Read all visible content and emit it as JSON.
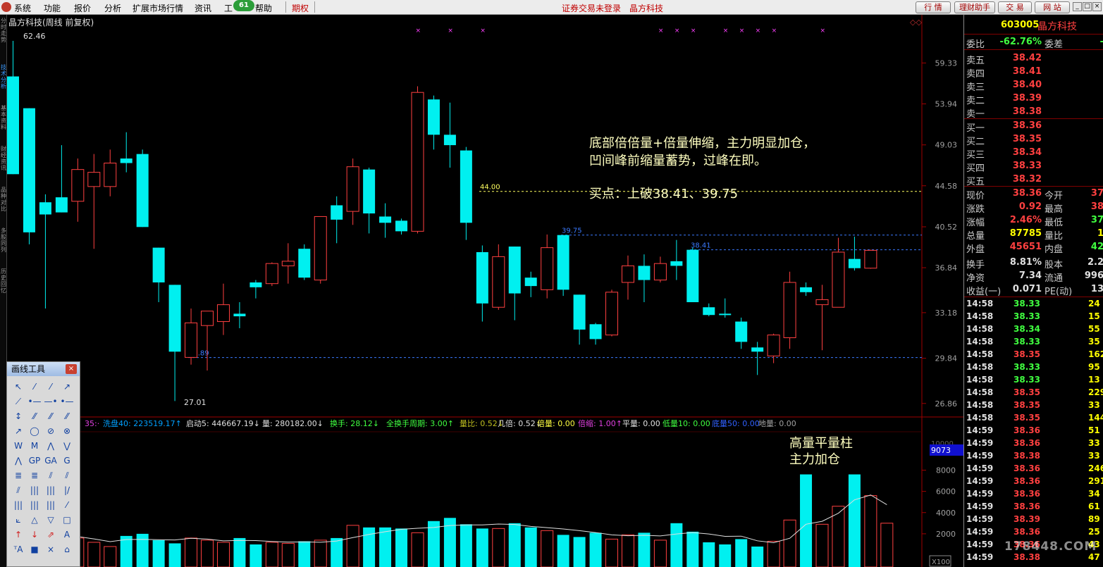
{
  "menubar": {
    "items": [
      "系统",
      "功能",
      "报价",
      "分析",
      "扩展市场行情",
      "资讯",
      "工",
      "帮助"
    ],
    "badge": "61",
    "qiquan": "期权",
    "status_text": "证券交易未登录",
    "status_name": "晶方科技",
    "right_buttons": [
      "行 情",
      "理财助手",
      "交 易",
      "网 站"
    ],
    "window_controls": [
      "_",
      "□",
      "×"
    ]
  },
  "left_tabs": [
    "分时走势",
    "技术分析",
    "基本资料",
    "财经资讯",
    "品种对比",
    "多股同列",
    "历史回忆"
  ],
  "chart": {
    "title": "晶方科技(周线 前复权)",
    "high_label": "62.46",
    "low_label": "27.01",
    "y_ticks": [
      "59.33",
      "53.94",
      "49.03",
      "44.58",
      "40.52",
      "36.84",
      "33.18",
      "29.84",
      "26.86"
    ],
    "y_values": [
      59.33,
      53.94,
      49.03,
      44.58,
      40.52,
      36.84,
      33.18,
      29.84,
      26.86
    ],
    "lines": [
      {
        "label": "44.00",
        "value": 44.0,
        "color": "#ffff60"
      },
      {
        "label": "39.75",
        "value": 39.75,
        "color": "#3a7aff"
      },
      {
        "label": "38.41",
        "value": 38.41,
        "color": "#3a7aff"
      },
      {
        "label": "29.89",
        "value": 29.89,
        "color": "#3a7aff"
      }
    ],
    "annotation_lines": [
      "底部倍倍量+倍量伸缩，主力明显加仓，",
      "凹间峰前缩量蓄势，过峰在即。"
    ],
    "buy_point": "买点：上破38.41、39.75",
    "signal_marks": [
      "×",
      "×",
      "×",
      "×",
      "×",
      "×",
      "×",
      "×",
      "×",
      "×",
      "×"
    ],
    "candles": [
      {
        "o": 57.5,
        "c": 45.8,
        "h": 62.46,
        "l": 45.8
      },
      {
        "o": 53.4,
        "c": 40.0,
        "h": 53.4,
        "l": 38.9
      },
      {
        "o": 42.9,
        "c": 41.7,
        "h": 43.7,
        "l": 33.5
      },
      {
        "o": 43.4,
        "c": 41.9,
        "h": 49.0,
        "l": 41.9
      },
      {
        "o": 43.0,
        "c": 46.3,
        "h": 47.5,
        "l": 41.0
      },
      {
        "o": 44.5,
        "c": 46.0,
        "h": 48.0,
        "l": 38.5
      },
      {
        "o": 44.5,
        "c": 47.0,
        "h": 48.5,
        "l": 43.5
      },
      {
        "o": 47.5,
        "c": 47.0,
        "h": 50.5,
        "l": 46.0
      },
      {
        "o": 48.0,
        "c": 40.5,
        "h": 48.5,
        "l": 40.5
      },
      {
        "o": 38.6,
        "c": 35.6,
        "h": 38.6,
        "l": 34.0
      },
      {
        "o": 35.4,
        "c": 30.3,
        "h": 35.4,
        "l": 27.01
      },
      {
        "o": 29.9,
        "c": 32.4,
        "h": 33.5,
        "l": 29.4
      },
      {
        "o": 32.2,
        "c": 33.3,
        "h": 33.3,
        "l": 29.0
      },
      {
        "o": 32.5,
        "c": 33.8,
        "h": 35.5,
        "l": 31.5
      },
      {
        "o": 33.1,
        "c": 32.9,
        "h": 34.0,
        "l": 32.0
      },
      {
        "o": 35.6,
        "c": 35.2,
        "h": 35.8,
        "l": 34.3
      },
      {
        "o": 35.5,
        "c": 37.2,
        "h": 37.3,
        "l": 35.3
      },
      {
        "o": 37.0,
        "c": 37.4,
        "h": 39.0,
        "l": 35.5
      },
      {
        "o": 38.5,
        "c": 36.0,
        "h": 38.9,
        "l": 35.8
      },
      {
        "o": 35.8,
        "c": 41.5,
        "h": 41.5,
        "l": 35.5
      },
      {
        "o": 42.6,
        "c": 41.2,
        "h": 43.5,
        "l": 39.0
      },
      {
        "o": 42.0,
        "c": 46.6,
        "h": 47.5,
        "l": 40.7
      },
      {
        "o": 46.3,
        "c": 41.8,
        "h": 46.5,
        "l": 39.9
      },
      {
        "o": 41.5,
        "c": 40.9,
        "h": 42.8,
        "l": 39.5
      },
      {
        "o": 41.1,
        "c": 40.1,
        "h": 41.3,
        "l": 39.8
      },
      {
        "o": 40.1,
        "c": 55.4,
        "h": 56.2,
        "l": 39.9
      },
      {
        "o": 54.5,
        "c": 50.2,
        "h": 55.0,
        "l": 48.5
      },
      {
        "o": 50.2,
        "c": 49.0,
        "h": 54.1,
        "l": 46.5
      },
      {
        "o": 48.4,
        "c": 40.9,
        "h": 48.8,
        "l": 39.3
      },
      {
        "o": 38.2,
        "c": 33.9,
        "h": 38.8,
        "l": 32.5
      },
      {
        "o": 33.6,
        "c": 37.8,
        "h": 38.9,
        "l": 33.4
      },
      {
        "o": 38.7,
        "c": 34.7,
        "h": 38.7,
        "l": 32.6
      },
      {
        "o": 36.0,
        "c": 35.3,
        "h": 36.5,
        "l": 34.4
      },
      {
        "o": 35.0,
        "c": 38.6,
        "h": 39.8,
        "l": 34.3
      },
      {
        "o": 39.75,
        "c": 35.0,
        "h": 39.75,
        "l": 34.5
      },
      {
        "o": 34.6,
        "c": 31.9,
        "h": 34.6,
        "l": 30.8
      },
      {
        "o": 32.3,
        "c": 31.2,
        "h": 32.4,
        "l": 30.8
      },
      {
        "o": 31.5,
        "c": 34.8,
        "h": 35.0,
        "l": 31.4
      },
      {
        "o": 35.6,
        "c": 37.0,
        "h": 37.9,
        "l": 34.2
      },
      {
        "o": 37.0,
        "c": 35.8,
        "h": 38.0,
        "l": 34.0
      },
      {
        "o": 35.8,
        "c": 37.2,
        "h": 37.8,
        "l": 35.6
      },
      {
        "o": 37.4,
        "c": 37.0,
        "h": 39.3,
        "l": 35.8
      },
      {
        "o": 38.41,
        "c": 34.0,
        "h": 38.6,
        "l": 34.0
      },
      {
        "o": 33.6,
        "c": 33.0,
        "h": 33.9,
        "l": 32.9
      },
      {
        "o": 33.1,
        "c": 33.0,
        "h": 34.3,
        "l": 32.8
      },
      {
        "o": 32.5,
        "c": 31.0,
        "h": 32.8,
        "l": 30.5
      },
      {
        "o": 30.6,
        "c": 30.3,
        "h": 31.0,
        "l": 28.7
      },
      {
        "o": 30.0,
        "c": 31.5,
        "h": 31.6,
        "l": 29.5
      },
      {
        "o": 31.3,
        "c": 35.6,
        "h": 36.5,
        "l": 30.5
      },
      {
        "o": 35.2,
        "c": 34.8,
        "h": 35.6,
        "l": 34.5
      },
      {
        "o": 33.8,
        "c": 34.2,
        "h": 35.4,
        "l": 30.4
      },
      {
        "o": 33.6,
        "c": 38.2,
        "h": 39.5,
        "l": 33.6
      },
      {
        "o": 37.6,
        "c": 36.8,
        "h": 39.6,
        "l": 36.6
      },
      {
        "o": 36.8,
        "c": 38.36,
        "h": 38.42,
        "l": 36.75
      }
    ],
    "volume": {
      "indicator_text": [
        {
          "text": "35:·",
          "color": "#e040e0"
        },
        {
          "text": "洗盘40: 223519.17↑",
          "color": "#00a0ff"
        },
        {
          "text": "启动5: 446667.19↓",
          "color": "#e0e0e0"
        },
        {
          "text": "量: 280182.00↓",
          "color": "#e0e0e0"
        },
        {
          "text": "换手: 28.12↓",
          "color": "#40ff40"
        },
        {
          "text": "全换手周期: 3.00↑",
          "color": "#40ff40"
        },
        {
          "text": "量比: 0.52↓",
          "color": "#c0c020"
        },
        {
          "text": "几倍: 0.52↓",
          "color": "#e0e0e0"
        },
        {
          "text": "倍量: 0.00",
          "color": "#ffff40"
        },
        {
          "text": "倍缩: 1.00↑",
          "color": "#e040e0"
        },
        {
          "text": "平量: 0.00",
          "color": "#e0e0e0"
        },
        {
          "text": "低量10: 0.00",
          "color": "#40ff40"
        },
        {
          "text": "底量50: 0.00",
          "color": "#3060ff"
        },
        {
          "text": "地量: 0.00",
          "color": "#a0a0a0"
        }
      ],
      "annotation_lines": [
        "高量平量柱",
        "主力加仓"
      ],
      "y_ticks": [
        "8000",
        "6000",
        "4000",
        "2000"
      ],
      "y_values": [
        8000,
        6000,
        4000,
        2000
      ],
      "top_tick": "10000",
      "cursor_label": "9073",
      "unit_label": "X100",
      "values": [
        2300,
        2100,
        800,
        1900,
        1600,
        1200,
        800,
        1800,
        2000,
        1400,
        1100,
        1600,
        1400,
        1200,
        1600,
        1000,
        1200,
        1100,
        1300,
        1400,
        1600,
        2800,
        2600,
        2600,
        2500,
        2100,
        3200,
        3500,
        2900,
        2500,
        2500,
        3000,
        2600,
        2300,
        1900,
        1700,
        2100,
        1500,
        1900,
        2100,
        1400,
        3000,
        2200,
        1200,
        1000,
        1500,
        800,
        1300,
        3300,
        7600,
        2900,
        4600,
        7600,
        5600,
        3000
      ]
    }
  },
  "quote": {
    "code": "603005",
    "name": "晶方科技",
    "weibi_label": "委比",
    "weibi_value": "-62.76%",
    "weicha_label": "委差",
    "weicha_value": "-",
    "asks": [
      {
        "label": "卖五",
        "price": "38.42"
      },
      {
        "label": "卖四",
        "price": "38.41"
      },
      {
        "label": "卖三",
        "price": "38.40"
      },
      {
        "label": "卖二",
        "price": "38.39"
      },
      {
        "label": "卖一",
        "price": "38.38"
      }
    ],
    "bids": [
      {
        "label": "买一",
        "price": "38.36"
      },
      {
        "label": "买二",
        "price": "38.35"
      },
      {
        "label": "买三",
        "price": "38.34"
      },
      {
        "label": "买四",
        "price": "38.33"
      },
      {
        "label": "买五",
        "price": "38.32"
      }
    ],
    "stats": [
      {
        "l1": "现价",
        "v1": "38.36",
        "c1": "#ff4040",
        "l2": "今开",
        "v2": "37",
        "c2": "#ff4040"
      },
      {
        "l1": "涨跌",
        "v1": "0.92",
        "c1": "#ff4040",
        "l2": "最高",
        "v2": "38",
        "c2": "#ff4040"
      },
      {
        "l1": "涨幅",
        "v1": "2.46%",
        "c1": "#ff4040",
        "l2": "最低",
        "v2": "37",
        "c2": "#40ff40"
      },
      {
        "l1": "总量",
        "v1": "87785",
        "c1": "#ffff00",
        "l2": "量比",
        "v2": "1",
        "c2": "#ffff00"
      },
      {
        "l1": "外盘",
        "v1": "45651",
        "c1": "#ff4040",
        "l2": "内盘",
        "v2": "42",
        "c2": "#40ff40"
      },
      {
        "l1": "换手",
        "v1": "8.81%",
        "c1": "#e0e0e0",
        "l2": "股本",
        "v2": "2.2",
        "c2": "#e0e0e0"
      },
      {
        "l1": "净资",
        "v1": "7.34",
        "c1": "#e0e0e0",
        "l2": "流通",
        "v2": "996",
        "c2": "#e0e0e0"
      },
      {
        "l1": "收益(一)",
        "v1": "0.071",
        "c1": "#e0e0e0",
        "l2": "PE(动)",
        "v2": "13",
        "c2": "#e0e0e0"
      }
    ],
    "ticks": [
      {
        "t": "14:58",
        "p": "38.33",
        "c": "#40ff40",
        "v": "24"
      },
      {
        "t": "14:58",
        "p": "38.33",
        "c": "#40ff40",
        "v": "15"
      },
      {
        "t": "14:58",
        "p": "38.34",
        "c": "#40ff40",
        "v": "55"
      },
      {
        "t": "14:58",
        "p": "38.33",
        "c": "#40ff40",
        "v": "35"
      },
      {
        "t": "14:58",
        "p": "38.35",
        "c": "#ff4040",
        "v": "162"
      },
      {
        "t": "14:58",
        "p": "38.33",
        "c": "#40ff40",
        "v": "95"
      },
      {
        "t": "14:58",
        "p": "38.33",
        "c": "#40ff40",
        "v": "13"
      },
      {
        "t": "14:58",
        "p": "38.35",
        "c": "#ff4040",
        "v": "229"
      },
      {
        "t": "14:58",
        "p": "38.35",
        "c": "#ff4040",
        "v": "33"
      },
      {
        "t": "14:58",
        "p": "38.35",
        "c": "#ff4040",
        "v": "144"
      },
      {
        "t": "14:59",
        "p": "38.36",
        "c": "#ff4040",
        "v": "51"
      },
      {
        "t": "14:59",
        "p": "38.36",
        "c": "#ff4040",
        "v": "33"
      },
      {
        "t": "14:59",
        "p": "38.38",
        "c": "#ff4040",
        "v": "33"
      },
      {
        "t": "14:59",
        "p": "38.36",
        "c": "#ff4040",
        "v": "246"
      },
      {
        "t": "14:59",
        "p": "38.36",
        "c": "#ff4040",
        "v": "291"
      },
      {
        "t": "14:59",
        "p": "38.36",
        "c": "#ff4040",
        "v": "34"
      },
      {
        "t": "14:59",
        "p": "38.36",
        "c": "#ff4040",
        "v": "61"
      },
      {
        "t": "14:59",
        "p": "38.39",
        "c": "#ff4040",
        "v": "89"
      },
      {
        "t": "14:59",
        "p": "38.36",
        "c": "#ff4040",
        "v": "25"
      },
      {
        "t": "14:59",
        "p": "38.36",
        "c": "#ff4040",
        "v": "43"
      },
      {
        "t": "14:59",
        "p": "38.38",
        "c": "#ff4040",
        "v": "47"
      }
    ]
  },
  "toolbox": {
    "title": "画线工具",
    "close": "×",
    "tools": [
      "↖",
      "⁄",
      "⁄",
      "↗",
      "⟋",
      "•—",
      "—•",
      "•—",
      "↕",
      "⁄⁄",
      "⁄⁄",
      "⁄⁄",
      "↗",
      "◯",
      "⊘",
      "⊗",
      "W",
      "M",
      "⋀",
      "⋁",
      "⋀",
      "GP",
      "GA",
      "G",
      "≣",
      "≣",
      "⫽",
      "⫽",
      "⫽",
      "|||",
      "|||",
      "|/",
      "|||",
      "|||",
      "|||",
      "⁄",
      "⟀",
      "△",
      "▽",
      "□",
      "↑",
      "↓",
      "⇗",
      "A",
      "ᵀA",
      "■",
      "×",
      "⌂"
    ]
  },
  "watermark": "178448.COM"
}
